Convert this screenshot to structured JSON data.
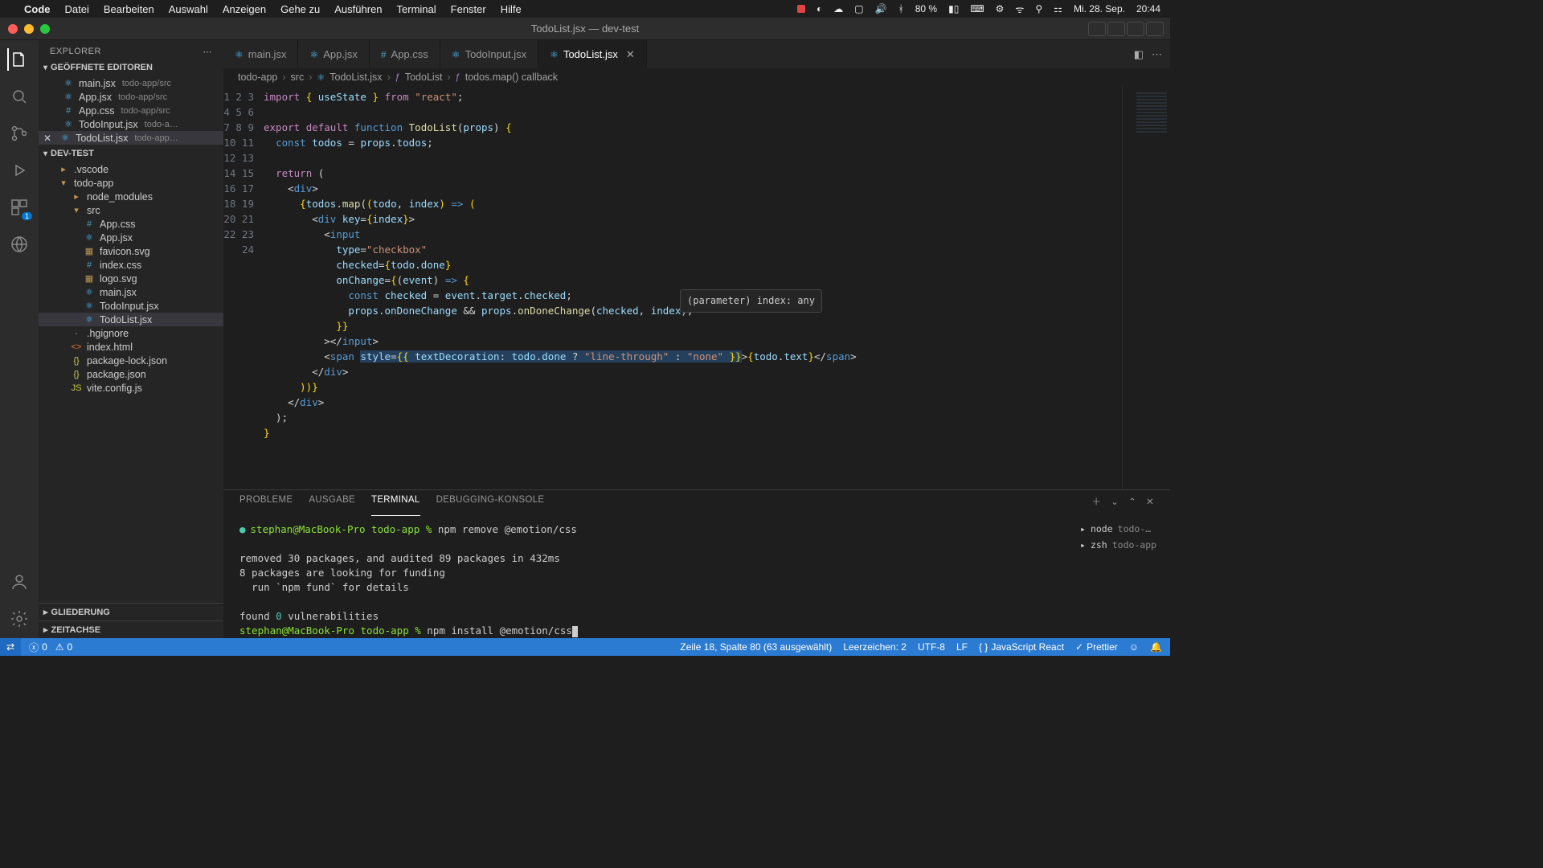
{
  "menubar": {
    "app": "Code",
    "items": [
      "Datei",
      "Bearbeiten",
      "Auswahl",
      "Anzeigen",
      "Gehe zu",
      "Ausführen",
      "Terminal",
      "Fenster",
      "Hilfe"
    ],
    "battery": "80 %",
    "date": "Mi. 28. Sep.",
    "time": "20:44"
  },
  "titlebar": {
    "title": "TodoList.jsx — dev-test"
  },
  "sidebar": {
    "title": "EXPLORER",
    "open_editors_label": "GEÖFFNETE EDITOREN",
    "open_editors": [
      {
        "name": "main.jsx",
        "dir": "todo-app/src",
        "type": "react"
      },
      {
        "name": "App.jsx",
        "dir": "todo-app/src",
        "type": "react"
      },
      {
        "name": "App.css",
        "dir": "todo-app/src",
        "type": "css"
      },
      {
        "name": "TodoInput.jsx",
        "dir": "todo-a…",
        "type": "react"
      },
      {
        "name": "TodoList.jsx",
        "dir": "todo-app…",
        "type": "react",
        "active": true
      }
    ],
    "project_label": "DEV-TEST",
    "tree": [
      {
        "name": ".vscode",
        "type": "folder",
        "depth": 0
      },
      {
        "name": "todo-app",
        "type": "folder",
        "depth": 0,
        "open": true
      },
      {
        "name": "node_modules",
        "type": "folder",
        "depth": 1
      },
      {
        "name": "src",
        "type": "folder",
        "depth": 1,
        "open": true
      },
      {
        "name": "App.css",
        "type": "css",
        "depth": 2
      },
      {
        "name": "App.jsx",
        "type": "react",
        "depth": 2
      },
      {
        "name": "favicon.svg",
        "type": "svg",
        "depth": 2
      },
      {
        "name": "index.css",
        "type": "css",
        "depth": 2
      },
      {
        "name": "logo.svg",
        "type": "svg",
        "depth": 2
      },
      {
        "name": "main.jsx",
        "type": "react",
        "depth": 2
      },
      {
        "name": "TodoInput.jsx",
        "type": "react",
        "depth": 2
      },
      {
        "name": "TodoList.jsx",
        "type": "react",
        "depth": 2,
        "active": true
      },
      {
        "name": ".hgignore",
        "type": "file",
        "depth": 1
      },
      {
        "name": "index.html",
        "type": "html",
        "depth": 1
      },
      {
        "name": "package-lock.json",
        "type": "json",
        "depth": 1
      },
      {
        "name": "package.json",
        "type": "json",
        "depth": 1
      },
      {
        "name": "vite.config.js",
        "type": "js",
        "depth": 1
      }
    ],
    "outline_label": "GLIEDERUNG",
    "timeline_label": "ZEITACHSE"
  },
  "tabs": [
    {
      "name": "main.jsx",
      "icon": "react"
    },
    {
      "name": "App.jsx",
      "icon": "react"
    },
    {
      "name": "App.css",
      "icon": "css"
    },
    {
      "name": "TodoInput.jsx",
      "icon": "react"
    },
    {
      "name": "TodoList.jsx",
      "icon": "react",
      "active": true
    }
  ],
  "breadcrumbs": [
    "todo-app",
    "src",
    "TodoList.jsx",
    "TodoList",
    "todos.map() callback"
  ],
  "code": {
    "line_count": 24,
    "hover": "(parameter) index: any"
  },
  "panel": {
    "tabs": [
      "PROBLEME",
      "AUSGABE",
      "TERMINAL",
      "DEBUGGING-KONSOLE"
    ],
    "active": "TERMINAL",
    "terminal_lines": [
      {
        "prompt": "stephan@MacBook-Pro todo-app % ",
        "cmd": "npm remove @emotion/css"
      },
      {
        "text": "removed 30 packages, and audited 89 packages in 432ms"
      },
      {
        "text": "8 packages are looking for funding"
      },
      {
        "text": "  run `npm fund` for details"
      },
      {
        "text": "found 0 vulnerabilities",
        "zero": true
      },
      {
        "prompt": "stephan@MacBook-Pro todo-app % ",
        "cmd": "npm install @emotion/css",
        "cursor": true
      }
    ],
    "side": [
      {
        "icon": "node",
        "label": "node",
        "dim": "todo-…"
      },
      {
        "icon": "zsh",
        "label": "zsh",
        "dim": "todo-app"
      }
    ]
  },
  "statusbar": {
    "errors": "0",
    "warnings": "0",
    "pos": "Zeile 18, Spalte 80 (63 ausgewählt)",
    "indent": "Leerzeichen: 2",
    "enc": "UTF-8",
    "eol": "LF",
    "lang": "JavaScript React",
    "prettier": "Prettier"
  }
}
